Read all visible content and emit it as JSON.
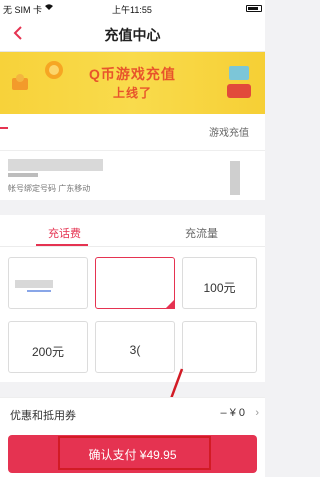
{
  "status_bar": {
    "carrier": "无 SIM 卡",
    "time": "上午11:55"
  },
  "nav": {
    "title": "充值中心",
    "back_icon": "chevron-left-icon"
  },
  "banner": {
    "line1": "Q币游戏充值",
    "line2": "上线了"
  },
  "game_row": {
    "label": "游戏充值"
  },
  "phone_card": {
    "hint": "帐号绑定号码 广东移动"
  },
  "tabs": [
    {
      "label": "充话费",
      "active": true
    },
    {
      "label": "充流量",
      "active": false
    }
  ],
  "amounts": [
    {
      "label": ""
    },
    {
      "label": ""
    },
    {
      "label": "100元"
    },
    {
      "label": "200元"
    },
    {
      "label": "3("
    },
    {
      "label": ""
    }
  ],
  "coupon": {
    "label": "优惠和抵用券",
    "value": "– ¥ 0"
  },
  "pay_button": {
    "label": "确认支付 ¥49.95"
  },
  "colors": {
    "accent": "#e53351",
    "banner_bg": "#f7d23a",
    "banner_text": "#e8542b",
    "annotation": "#d21b25"
  }
}
